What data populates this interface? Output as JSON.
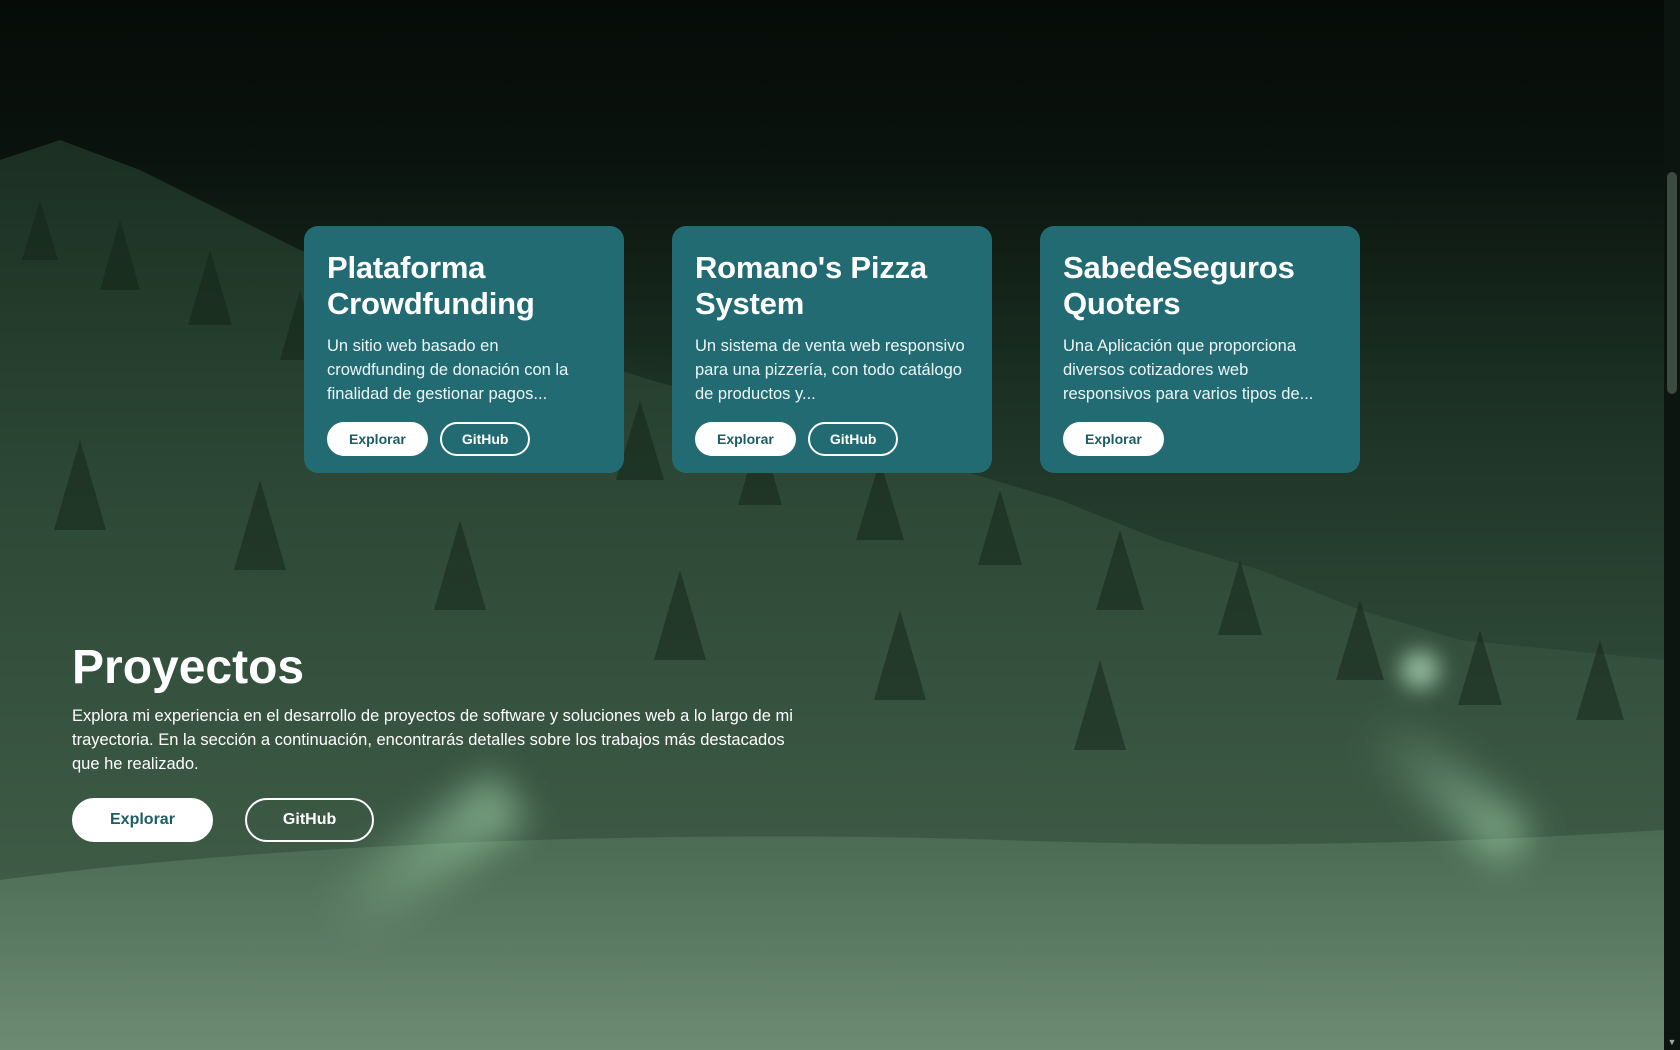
{
  "cards": [
    {
      "title": "Plataforma Crowdfunding",
      "description": "Un sitio web basado en crowdfunding de donación con la finalidad de gestionar pagos...",
      "explore_label": "Explorar",
      "github_label": "GitHub"
    },
    {
      "title": "Romano's Pizza System",
      "description": "Un sistema de venta web responsivo para una pizzería, con todo catálogo de productos y...",
      "explore_label": "Explorar",
      "github_label": "GitHub"
    },
    {
      "title": "SabedeSeguros Quoters",
      "description": "Una Aplicación que proporciona diversos cotizadores web responsivos para varios tipos de...",
      "explore_label": "Explorar"
    }
  ],
  "hero": {
    "title": "Proyectos",
    "description": "Explora mi experiencia en el desarrollo de proyectos de software y soluciones web a lo largo de mi trayectoria. En la sección a continuación, encontrarás detalles sobre los trabajos más destacados que he realizado.",
    "explore_label": "Explorar",
    "github_label": "GitHub"
  },
  "colors": {
    "card_bg": "#226b73",
    "background": "#0a120d"
  }
}
